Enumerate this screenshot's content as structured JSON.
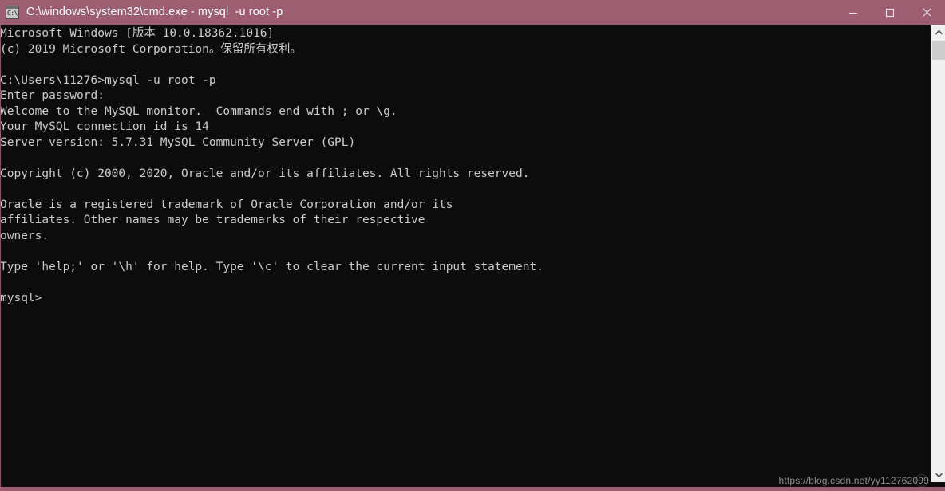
{
  "window": {
    "title": "C:\\windows\\system32\\cmd.exe - mysql  -u root -p",
    "icon_name": "cmd-exe-icon",
    "icon_text": "C:\\",
    "titlebar_color": "#9d5e72",
    "background_color": "#0c0c0c",
    "text_color": "#cccccc"
  },
  "controls": {
    "minimize_label": "Minimize",
    "maximize_label": "Maximize",
    "close_label": "Close"
  },
  "console": {
    "lines": [
      "Microsoft Windows [版本 10.0.18362.1016]",
      "(c) 2019 Microsoft Corporation。保留所有权利。",
      "",
      "C:\\Users\\11276>mysql -u root -p",
      "Enter password:",
      "Welcome to the MySQL monitor.  Commands end with ; or \\g.",
      "Your MySQL connection id is 14",
      "Server version: 5.7.31 MySQL Community Server (GPL)",
      "",
      "Copyright (c) 2000, 2020, Oracle and/or its affiliates. All rights reserved.",
      "",
      "Oracle is a registered trademark of Oracle Corporation and/or its",
      "affiliates. Other names may be trademarks of their respective",
      "owners.",
      "",
      "Type 'help;' or '\\h' for help. Type '\\c' to clear the current input statement.",
      "",
      "mysql>"
    ]
  },
  "scrollbar": {
    "up_arrow_label": "Scroll up",
    "down_arrow_label": "Scroll down",
    "thumb_label": "Scroll thumb"
  },
  "watermark": {
    "url": "https://blog.csdn.net/yy112762099"
  }
}
